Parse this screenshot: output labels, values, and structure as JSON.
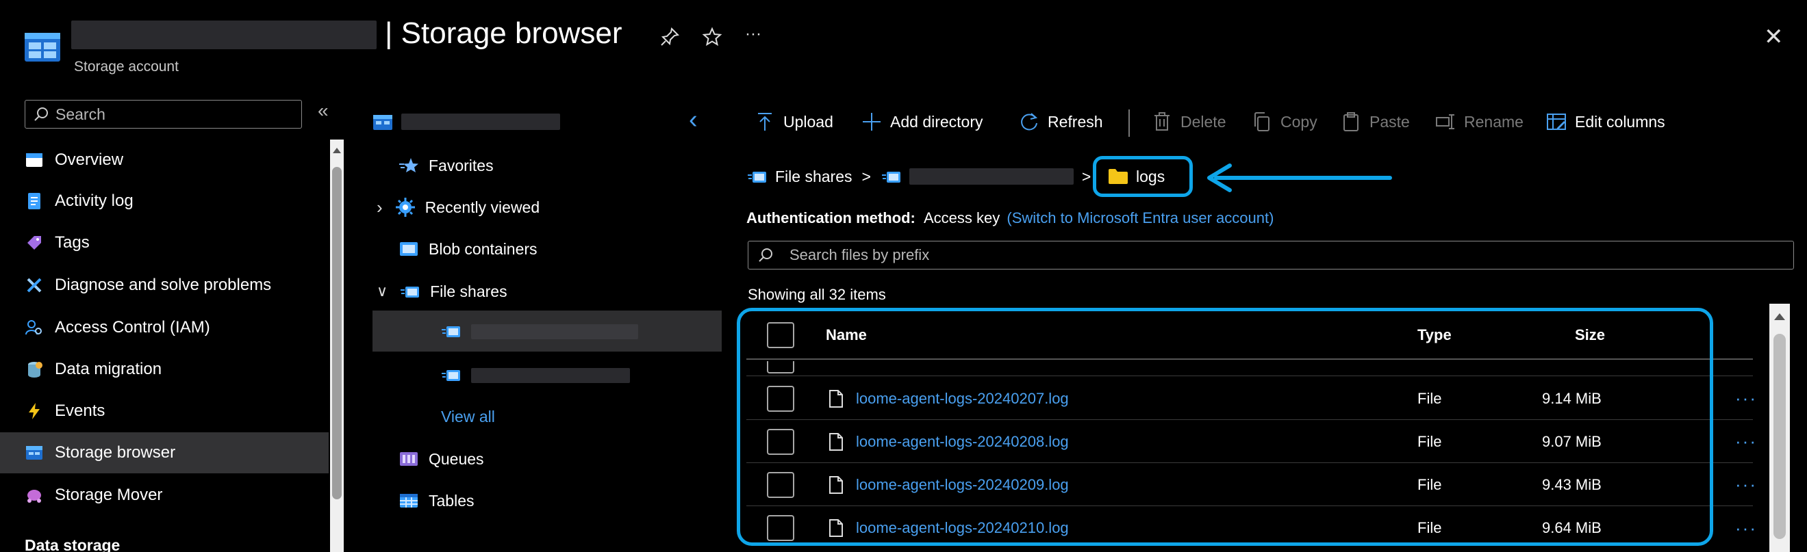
{
  "header": {
    "title": "| Storage browser",
    "subtitle": "Storage account",
    "more_label": "···",
    "close_label": "✕"
  },
  "nav": {
    "search_placeholder": "Search",
    "collapse_label": "«",
    "items": [
      {
        "label": "Overview"
      },
      {
        "label": "Activity log"
      },
      {
        "label": "Tags"
      },
      {
        "label": "Diagnose and solve problems"
      },
      {
        "label": "Access Control (IAM)"
      },
      {
        "label": "Data migration"
      },
      {
        "label": "Events"
      },
      {
        "label": "Storage browser"
      },
      {
        "label": "Storage Mover"
      }
    ],
    "section_label": "Data storage"
  },
  "tree": {
    "back_label": "‹",
    "favorites": "Favorites",
    "recently_viewed": "Recently viewed",
    "blob_containers": "Blob containers",
    "file_shares": "File shares",
    "view_all": "View all",
    "queues": "Queues",
    "tables": "Tables"
  },
  "toolbar": {
    "upload": "Upload",
    "add_directory": "Add directory",
    "refresh": "Refresh",
    "delete": "Delete",
    "copy": "Copy",
    "paste": "Paste",
    "rename": "Rename",
    "edit_columns": "Edit columns"
  },
  "breadcrumb": {
    "root": "File shares",
    "sep": ">",
    "current": "logs"
  },
  "auth": {
    "label": "Authentication method:",
    "value": "Access key",
    "switch_link": "(Switch to Microsoft Entra user account)"
  },
  "search_files": {
    "placeholder": "Search files by prefix"
  },
  "list": {
    "count_text": "Showing all 32 items",
    "columns": {
      "name": "Name",
      "type": "Type",
      "size": "Size"
    },
    "rows": [
      {
        "name": "loome-agent-logs-20240207.log",
        "type": "File",
        "size": "9.14 MiB"
      },
      {
        "name": "loome-agent-logs-20240208.log",
        "type": "File",
        "size": "9.07 MiB"
      },
      {
        "name": "loome-agent-logs-20240209.log",
        "type": "File",
        "size": "9.43 MiB"
      },
      {
        "name": "loome-agent-logs-20240210.log",
        "type": "File",
        "size": "9.64 MiB"
      }
    ],
    "row_more": "···"
  },
  "colors": {
    "accent": "#4aa0f0",
    "highlight": "#0ea5e9",
    "background": "#000000",
    "active_nav": "#333335"
  }
}
